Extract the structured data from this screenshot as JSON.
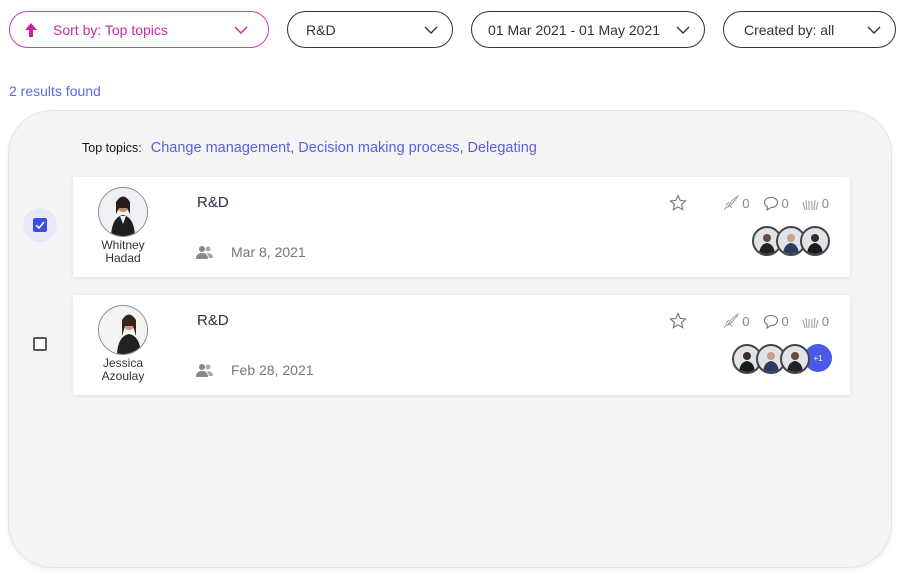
{
  "filters": {
    "sort_label": "Sort by: Top topics",
    "department": "R&D",
    "date_range": "01 Mar 2021 - 01 May 2021",
    "created_by": "Created by: all"
  },
  "results_text": "2 results found",
  "top_topics": {
    "label": "Top topics:",
    "value": "Change management, Decision making process, Delegating"
  },
  "cards": [
    {
      "checked": true,
      "author_first": "Whitney",
      "author_last": "Hadad",
      "title": "R&D",
      "date": "Mar 8, 2021",
      "boosts": "0",
      "comments": "0",
      "claps": "0",
      "extra_participants": ""
    },
    {
      "checked": false,
      "author_first": "Jessica",
      "author_last": "Azoulay",
      "title": "R&D",
      "date": "Feb 28, 2021",
      "boosts": "0",
      "comments": "0",
      "claps": "0",
      "extra_participants": "+1"
    }
  ],
  "colors": {
    "accent_pink": "#c62ba6",
    "accent_blue": "#5a5fe0",
    "checkbox_blue": "#3d4fe0"
  }
}
